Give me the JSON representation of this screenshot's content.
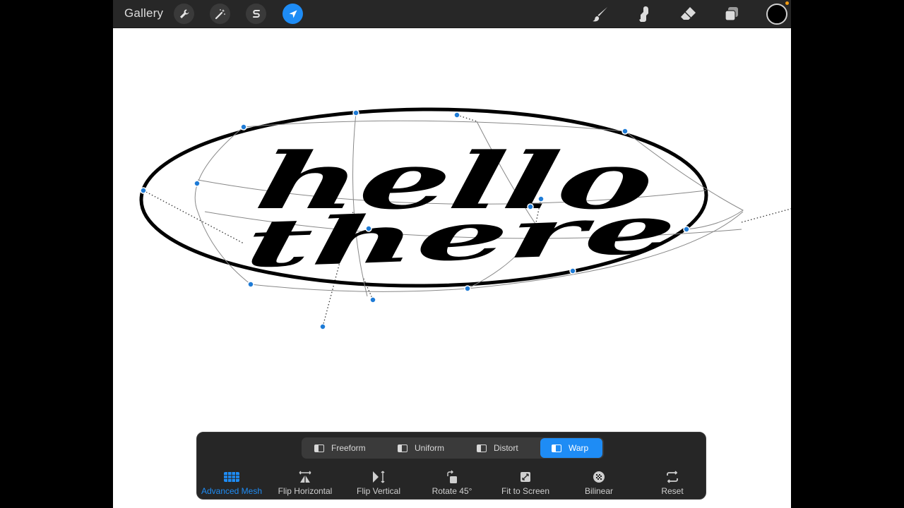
{
  "topbar": {
    "gallery_label": "Gallery",
    "actions_icon": "wrench-icon",
    "adjustments_icon": "magic-wand-icon",
    "selection_icon": "selection-s-icon",
    "transform_icon": "transform-arrow-icon",
    "brush_icon": "brush-icon",
    "smudge_icon": "smudge-icon",
    "eraser_icon": "eraser-icon",
    "layers_icon": "layers-icon",
    "current_color": "#000000",
    "accent_color": "#1e8cf5"
  },
  "canvas": {
    "text_line_1": "hello",
    "text_line_2": "there"
  },
  "transform": {
    "modes": [
      {
        "label": "Freeform",
        "active": false
      },
      {
        "label": "Uniform",
        "active": false
      },
      {
        "label": "Distort",
        "active": false
      },
      {
        "label": "Warp",
        "active": true
      }
    ],
    "options": [
      {
        "label": "Advanced Mesh",
        "icon": "mesh-grid-icon",
        "active": true
      },
      {
        "label": "Flip Horizontal",
        "icon": "flip-horizontal-icon",
        "active": false
      },
      {
        "label": "Flip Vertical",
        "icon": "flip-vertical-icon",
        "active": false
      },
      {
        "label": "Rotate 45°",
        "icon": "rotate-icon",
        "active": false
      },
      {
        "label": "Fit to Screen",
        "icon": "fit-to-screen-icon",
        "active": false
      },
      {
        "label": "Bilinear",
        "icon": "bilinear-icon",
        "active": false
      },
      {
        "label": "Reset",
        "icon": "reset-icon",
        "active": false
      }
    ]
  }
}
